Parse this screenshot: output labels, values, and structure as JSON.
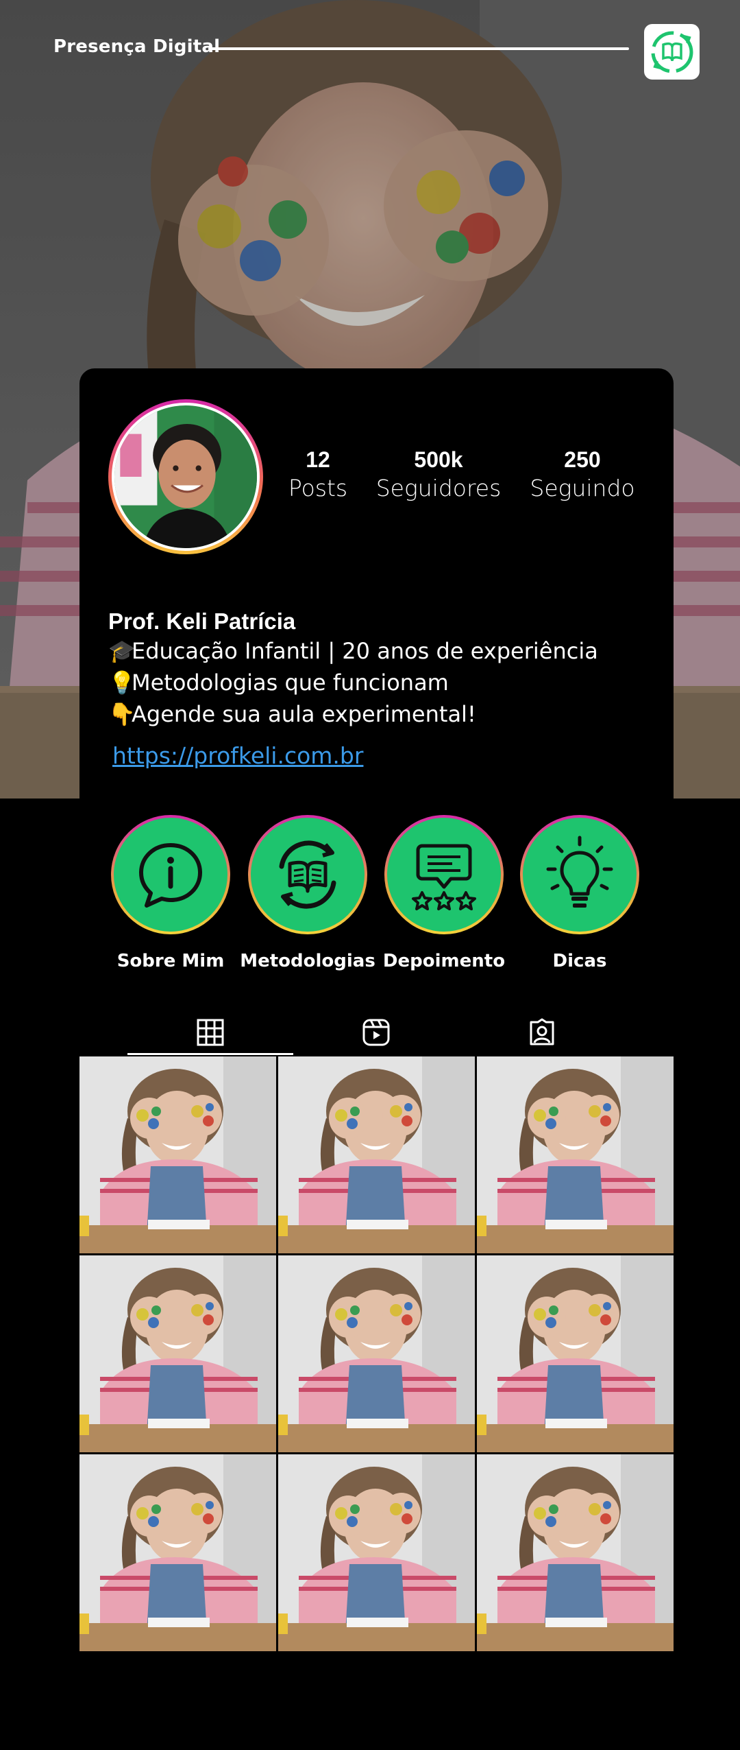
{
  "header": {
    "brand": "Presença Digital",
    "logo_icon": "book-cycle-icon",
    "accent": "#1ec46e"
  },
  "profile": {
    "avatar_icon": "teacher-avatar",
    "stats": [
      {
        "value": "12",
        "label": "Posts"
      },
      {
        "value": "500k",
        "label": "Seguidores"
      },
      {
        "value": "250",
        "label": "Seguindo"
      }
    ],
    "name": "Prof. Keli Patrícia",
    "bio": [
      {
        "emoji": "🎓",
        "text": "Educação Infantil | 20 anos de experiência"
      },
      {
        "emoji": "💡",
        "text": "Metodologias que funcionam"
      },
      {
        "emoji": "👇",
        "text": "Agende sua aula experimental!"
      }
    ],
    "link": "https://profkeli.com.br",
    "link_color": "#3b9ae8"
  },
  "highlights": [
    {
      "label": "Sobre Mim",
      "icon": "info-chat-icon"
    },
    {
      "label": "Metodologias",
      "icon": "book-cycle-icon"
    },
    {
      "label": "Depoimento",
      "icon": "review-stars-icon"
    },
    {
      "label": "Dicas",
      "icon": "lightbulb-icon"
    }
  ],
  "tabs": [
    {
      "name": "grid",
      "icon": "grid-icon",
      "active": true
    },
    {
      "name": "reels",
      "icon": "reels-icon",
      "active": false
    },
    {
      "name": "tagged",
      "icon": "tagged-icon",
      "active": false
    }
  ],
  "posts_count": 9
}
